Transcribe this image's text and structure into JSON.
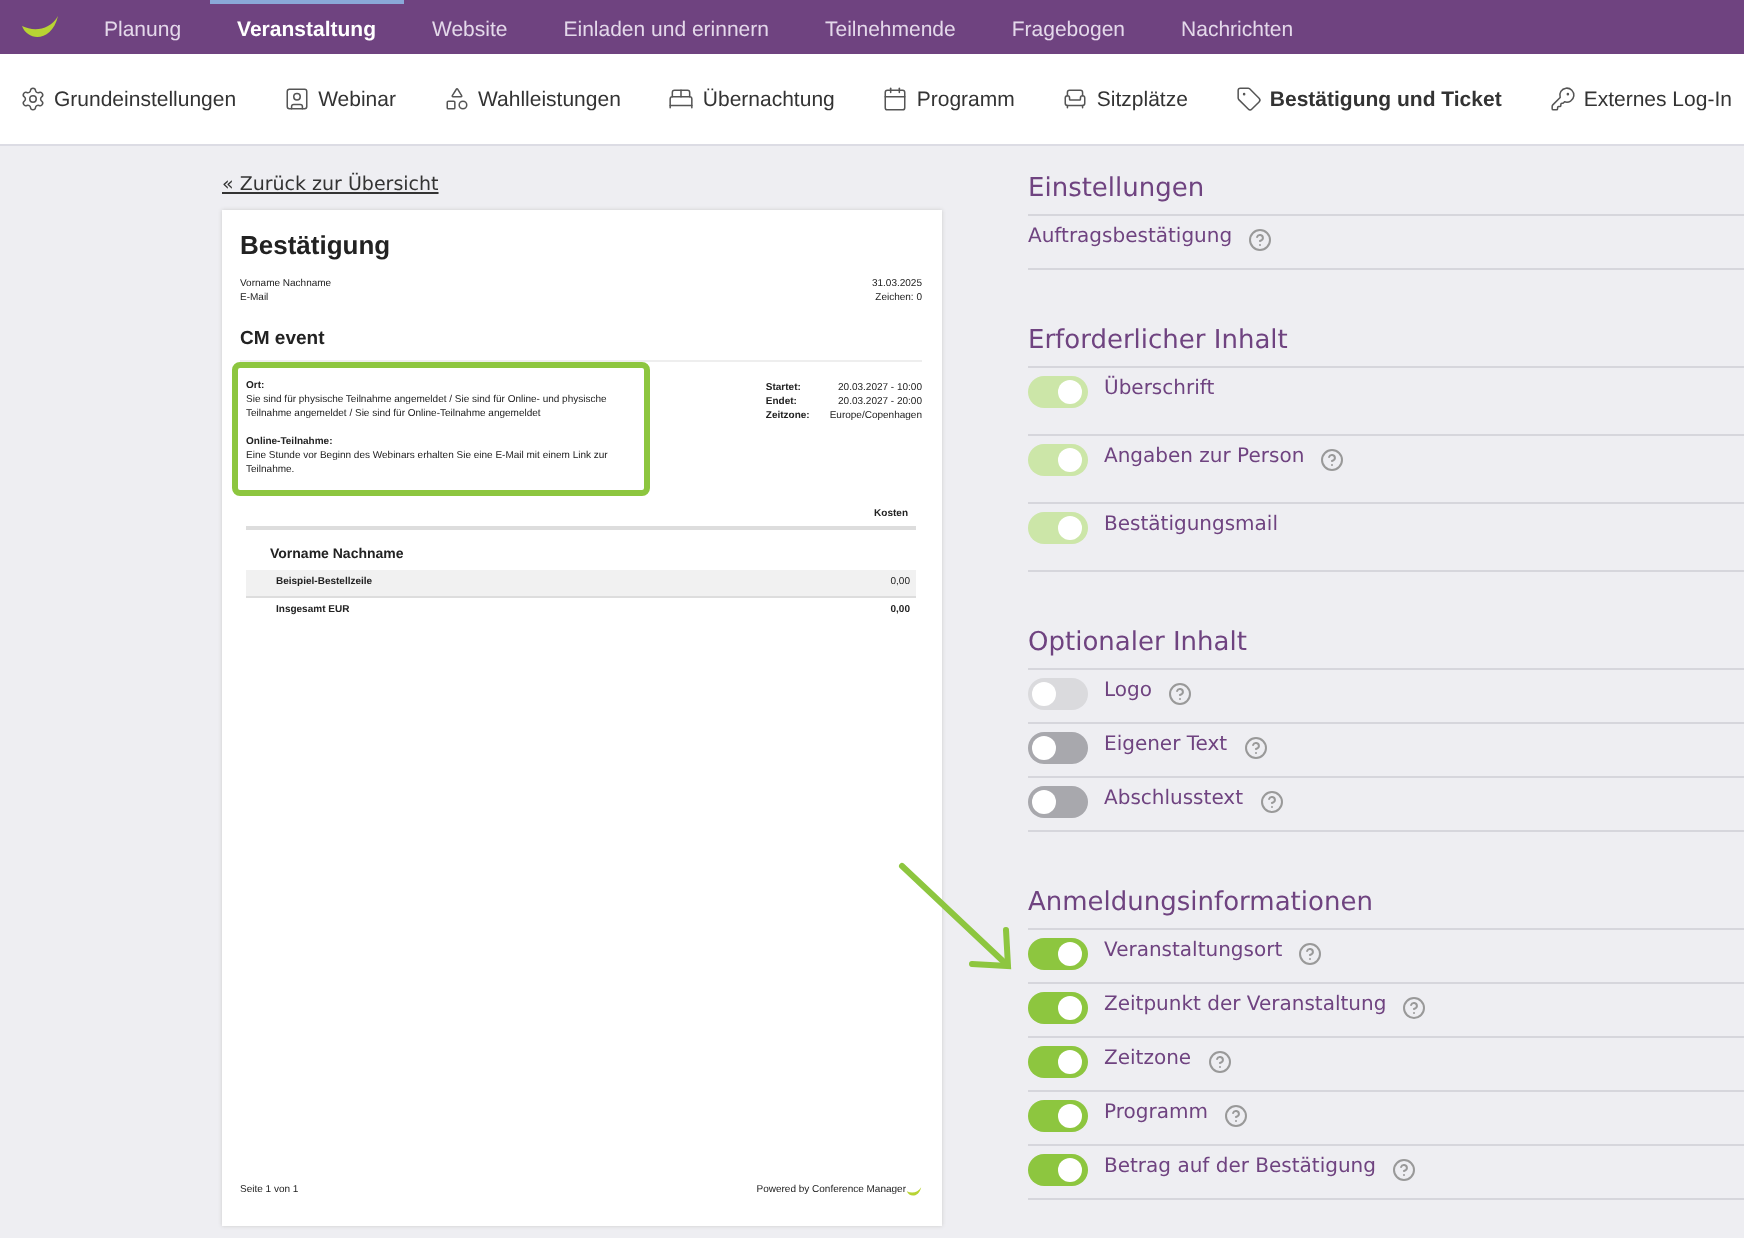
{
  "top_nav": {
    "items": [
      {
        "label": "Planung",
        "selected": false
      },
      {
        "label": "Veranstaltung",
        "selected": true
      },
      {
        "label": "Website",
        "selected": false
      },
      {
        "label": "Einladen und erinnern",
        "selected": false
      },
      {
        "label": "Teilnehmende",
        "selected": false
      },
      {
        "label": "Fragebogen",
        "selected": false
      },
      {
        "label": "Nachrichten",
        "selected": false
      }
    ]
  },
  "sub_nav": {
    "items": [
      {
        "label": "Grundeinstellungen",
        "selected": false
      },
      {
        "label": "Webinar",
        "selected": false
      },
      {
        "label": "Wahlleistungen",
        "selected": false
      },
      {
        "label": "Übernachtung",
        "selected": false
      },
      {
        "label": "Programm",
        "selected": false
      },
      {
        "label": "Sitzplätze",
        "selected": false
      },
      {
        "label": "Bestätigung und Ticket",
        "selected": true
      },
      {
        "label": "Externes Log-In",
        "selected": false
      }
    ]
  },
  "back_link": "« Zurück zur Übersicht",
  "document": {
    "title": "Bestätigung",
    "recipient": [
      "Vorname Nachname",
      "E-Mail"
    ],
    "date": "31.03.2025",
    "reference": "Zeichen: 0",
    "event": "CM event",
    "info_blocks": [
      {
        "heading": "Ort:",
        "text": "Sie sind für physische Teilnahme angemeldet / Sie sind für Online- und physische Teilnahme angemeldet / Sie sind für Online-Teilnahme angemeldet"
      },
      {
        "heading": "Online-Teilnahme:",
        "text": "Eine Stunde vor Beginn des Webinars erhalten Sie eine E-Mail mit einem Link zur Teilnahme."
      }
    ],
    "details": [
      {
        "label": "Startet:",
        "value": "20.03.2027 - 10:00"
      },
      {
        "label": "Endet:",
        "value": "20.03.2027 - 20:00"
      },
      {
        "label": "Zeitzone:",
        "value": "Europe/Copenhagen"
      }
    ],
    "cost_header": "Kosten",
    "person": "Vorname Nachname",
    "line_item": {
      "label": "Beispiel-Bestellzeile",
      "value": "0,00"
    },
    "total": {
      "label": "Insgesamt EUR",
      "value": "0,00"
    },
    "page": "Seite 1 von 1",
    "powered_by": "Powered by Conference Manager"
  },
  "sections": [
    {
      "title": "Einstellungen",
      "rows": [
        {
          "kind": "text",
          "label": "Auftragsbestätigung",
          "help": true
        }
      ]
    },
    {
      "title": "Erforderlicher Inhalt",
      "rows": [
        {
          "kind": "toggle",
          "label": "Überschrift",
          "on": true,
          "disabled": true,
          "help": false
        },
        {
          "kind": "toggle",
          "label": "Angaben zur Person",
          "on": true,
          "disabled": true,
          "help": true
        },
        {
          "kind": "toggle",
          "label": "Bestätigungsmail",
          "on": true,
          "disabled": true,
          "help": false
        }
      ]
    },
    {
      "title": "Optionaler Inhalt",
      "rows": [
        {
          "kind": "toggle",
          "label": "Logo",
          "on": false,
          "disabled": true,
          "help": true
        },
        {
          "kind": "toggle",
          "label": "Eigener Text",
          "on": false,
          "disabled": false,
          "help": true
        },
        {
          "kind": "toggle",
          "label": "Abschlusstext",
          "on": false,
          "disabled": false,
          "help": true
        }
      ]
    },
    {
      "title": "Anmeldungsinformationen",
      "rows": [
        {
          "kind": "toggle",
          "label": "Veranstaltungsort",
          "on": true,
          "disabled": false,
          "help": true
        },
        {
          "kind": "toggle",
          "label": "Zeitpunkt der Veranstaltung",
          "on": true,
          "disabled": false,
          "help": true
        },
        {
          "kind": "toggle",
          "label": "Zeitzone",
          "on": true,
          "disabled": false,
          "help": true
        },
        {
          "kind": "toggle",
          "label": "Programm",
          "on": true,
          "disabled": false,
          "help": true
        },
        {
          "kind": "toggle",
          "label": "Betrag auf der Bestätigung",
          "on": true,
          "disabled": false,
          "help": true
        }
      ]
    }
  ]
}
